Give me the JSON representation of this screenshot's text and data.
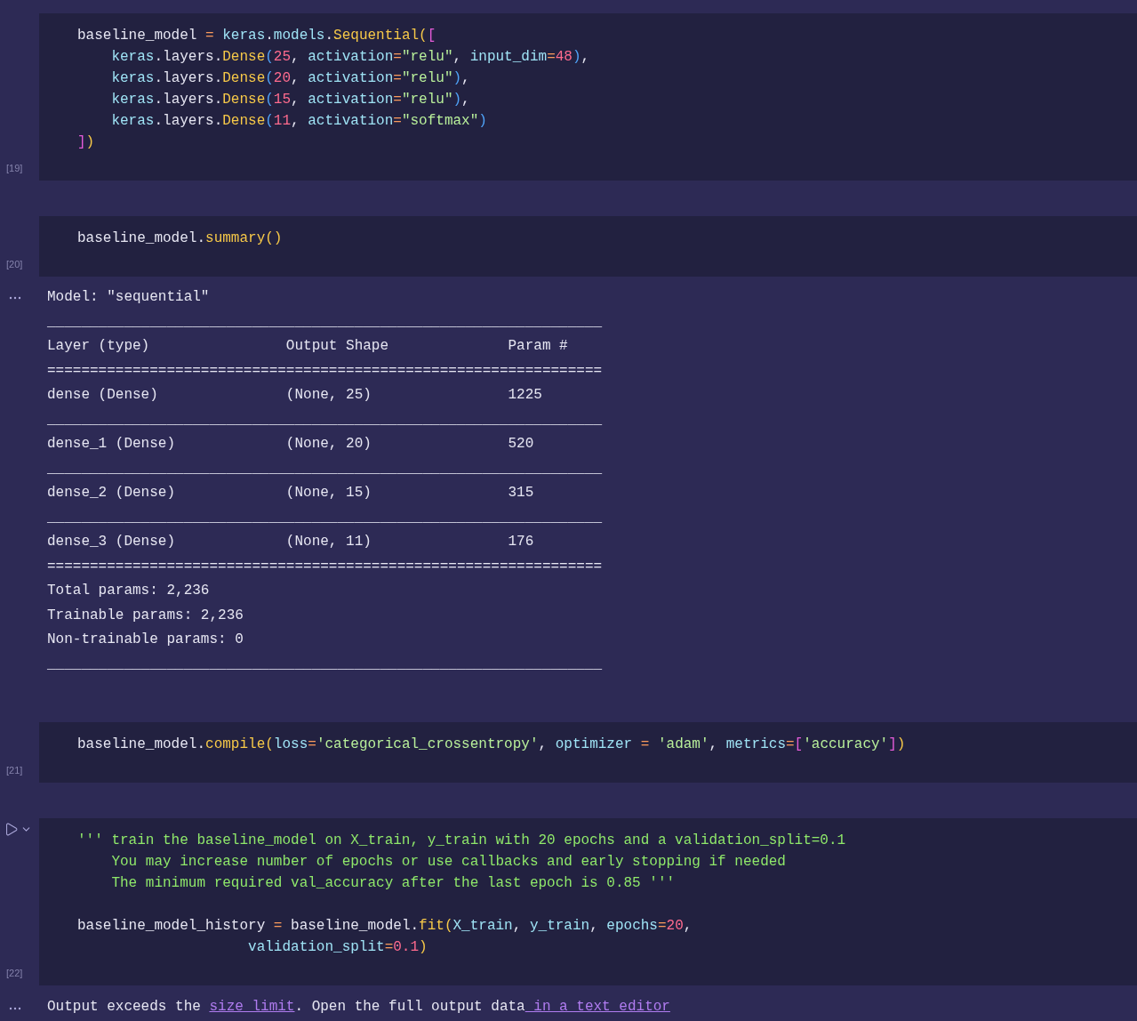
{
  "cells": [
    {
      "kind": "code",
      "execution_count": "[19]",
      "run_controls": false,
      "paragraphs": [
        [
          [
            {
              "text": "baseline_model ",
              "kind": "plain"
            },
            {
              "text": "=",
              "kind": "op"
            },
            {
              "text": " keras",
              "kind": "var"
            },
            {
              "text": ".",
              "kind": "plain"
            },
            {
              "text": "models",
              "kind": "var"
            },
            {
              "text": ".",
              "kind": "plain"
            },
            {
              "text": "Sequential",
              "kind": "fn"
            },
            {
              "text": "(",
              "kind": "b1"
            },
            {
              "text": "[",
              "kind": "b2"
            }
          ],
          [
            {
              "text": "    keras",
              "kind": "var"
            },
            {
              "text": ".layers.",
              "kind": "plain"
            },
            {
              "text": "Dense",
              "kind": "fn"
            },
            {
              "text": "(",
              "kind": "b3"
            },
            {
              "text": "25",
              "kind": "num"
            },
            {
              "text": ", ",
              "kind": "plain"
            },
            {
              "text": "activation",
              "kind": "var"
            },
            {
              "text": "=",
              "kind": "op"
            },
            {
              "text": "\"relu\"",
              "kind": "str"
            },
            {
              "text": ", ",
              "kind": "plain"
            },
            {
              "text": "input_dim",
              "kind": "var"
            },
            {
              "text": "=",
              "kind": "op"
            },
            {
              "text": "48",
              "kind": "num"
            },
            {
              "text": ")",
              "kind": "b3"
            },
            {
              "text": ",",
              "kind": "plain"
            }
          ],
          [
            {
              "text": "    keras",
              "kind": "var"
            },
            {
              "text": ".layers.",
              "kind": "plain"
            },
            {
              "text": "Dense",
              "kind": "fn"
            },
            {
              "text": "(",
              "kind": "b3"
            },
            {
              "text": "20",
              "kind": "num"
            },
            {
              "text": ", ",
              "kind": "plain"
            },
            {
              "text": "activation",
              "kind": "var"
            },
            {
              "text": "=",
              "kind": "op"
            },
            {
              "text": "\"relu\"",
              "kind": "str"
            },
            {
              "text": ")",
              "kind": "b3"
            },
            {
              "text": ",",
              "kind": "plain"
            }
          ],
          [
            {
              "text": "    keras",
              "kind": "var"
            },
            {
              "text": ".layers.",
              "kind": "plain"
            },
            {
              "text": "Dense",
              "kind": "fn"
            },
            {
              "text": "(",
              "kind": "b3"
            },
            {
              "text": "15",
              "kind": "num"
            },
            {
              "text": ", ",
              "kind": "plain"
            },
            {
              "text": "activation",
              "kind": "var"
            },
            {
              "text": "=",
              "kind": "op"
            },
            {
              "text": "\"relu\"",
              "kind": "str"
            },
            {
              "text": ")",
              "kind": "b3"
            },
            {
              "text": ",",
              "kind": "plain"
            }
          ],
          [
            {
              "text": "    keras",
              "kind": "var"
            },
            {
              "text": ".layers.",
              "kind": "plain"
            },
            {
              "text": "Dense",
              "kind": "fn"
            },
            {
              "text": "(",
              "kind": "b3"
            },
            {
              "text": "11",
              "kind": "num"
            },
            {
              "text": ", ",
              "kind": "plain"
            },
            {
              "text": "activation",
              "kind": "var"
            },
            {
              "text": "=",
              "kind": "op"
            },
            {
              "text": "\"softmax\"",
              "kind": "str"
            },
            {
              "text": ")",
              "kind": "b3"
            }
          ],
          [
            {
              "text": "]",
              "kind": "b2"
            },
            {
              "text": ")",
              "kind": "b1"
            }
          ]
        ]
      ]
    },
    {
      "kind": "code",
      "execution_count": "[20]",
      "run_controls": false,
      "paragraphs": [
        [
          [
            {
              "text": "baseline_model.",
              "kind": "plain"
            },
            {
              "text": "summary",
              "kind": "fn"
            },
            {
              "text": "()",
              "kind": "b1"
            }
          ]
        ]
      ]
    },
    {
      "kind": "output",
      "lines": [
        "Model: \"sequential\"",
        "_________________________________________________________________",
        "Layer (type)                Output Shape              Param #",
        "=================================================================",
        "dense (Dense)               (None, 25)                1225",
        "_________________________________________________________________",
        "dense_1 (Dense)             (None, 20)                520",
        "_________________________________________________________________",
        "dense_2 (Dense)             (None, 15)                315",
        "_________________________________________________________________",
        "dense_3 (Dense)             (None, 11)                176",
        "=================================================================",
        "Total params: 2,236",
        "Trainable params: 2,236",
        "Non-trainable params: 0",
        "_________________________________________________________________"
      ]
    },
    {
      "kind": "code",
      "execution_count": "[21]",
      "run_controls": false,
      "paragraphs": [
        [
          [
            {
              "text": "baseline_model.",
              "kind": "plain"
            },
            {
              "text": "compile",
              "kind": "fn"
            },
            {
              "text": "(",
              "kind": "b1"
            },
            {
              "text": "loss",
              "kind": "var"
            },
            {
              "text": "=",
              "kind": "op"
            },
            {
              "text": "'categorical_crossentropy'",
              "kind": "str"
            },
            {
              "text": ", ",
              "kind": "plain"
            },
            {
              "text": "optimizer",
              "kind": "var"
            },
            {
              "text": " = ",
              "kind": "op"
            },
            {
              "text": "'adam'",
              "kind": "str"
            },
            {
              "text": ", ",
              "kind": "plain"
            },
            {
              "text": "metrics",
              "kind": "var"
            },
            {
              "text": "=",
              "kind": "op"
            },
            {
              "text": "[",
              "kind": "b2"
            },
            {
              "text": "'accuracy'",
              "kind": "str"
            },
            {
              "text": "]",
              "kind": "b2"
            },
            {
              "text": ")",
              "kind": "b1"
            }
          ]
        ]
      ]
    },
    {
      "kind": "code",
      "execution_count": "[22]",
      "run_controls": true,
      "paragraphs": [
        [
          [
            {
              "text": "''' train the baseline_model on X_train, y_train with 20 epochs and a validation_split=0.1",
              "kind": "doc"
            }
          ],
          [
            {
              "text": "    You may increase number of epochs or use callbacks and early stopping if needed",
              "kind": "doc"
            }
          ],
          [
            {
              "text": "    The minimum required val_accuracy after the last epoch is 0.85 '''",
              "kind": "doc"
            }
          ]
        ],
        [
          [
            {
              "text": "baseline_model_history ",
              "kind": "plain"
            },
            {
              "text": "=",
              "kind": "op"
            },
            {
              "text": " baseline_model.",
              "kind": "plain"
            },
            {
              "text": "fit",
              "kind": "fn"
            },
            {
              "text": "(",
              "kind": "b1"
            },
            {
              "text": "X_train",
              "kind": "var"
            },
            {
              "text": ", ",
              "kind": "plain"
            },
            {
              "text": "y_train",
              "kind": "var"
            },
            {
              "text": ", ",
              "kind": "plain"
            },
            {
              "text": "epochs",
              "kind": "var"
            },
            {
              "text": "=",
              "kind": "op"
            },
            {
              "text": "20",
              "kind": "num"
            },
            {
              "text": ",",
              "kind": "plain"
            }
          ],
          [
            {
              "text": "                    validation_split",
              "kind": "var"
            },
            {
              "text": "=",
              "kind": "op"
            },
            {
              "text": "0.1",
              "kind": "num"
            },
            {
              "text": ")",
              "kind": "b1"
            }
          ]
        ]
      ]
    },
    {
      "kind": "message",
      "parts": [
        {
          "text": "Output exceeds the ",
          "kind": "text"
        },
        {
          "text": "size limit",
          "kind": "link"
        },
        {
          "text": ". Open the full output data",
          "kind": "text"
        },
        {
          "text": " in a text editor",
          "kind": "link"
        }
      ]
    }
  ]
}
